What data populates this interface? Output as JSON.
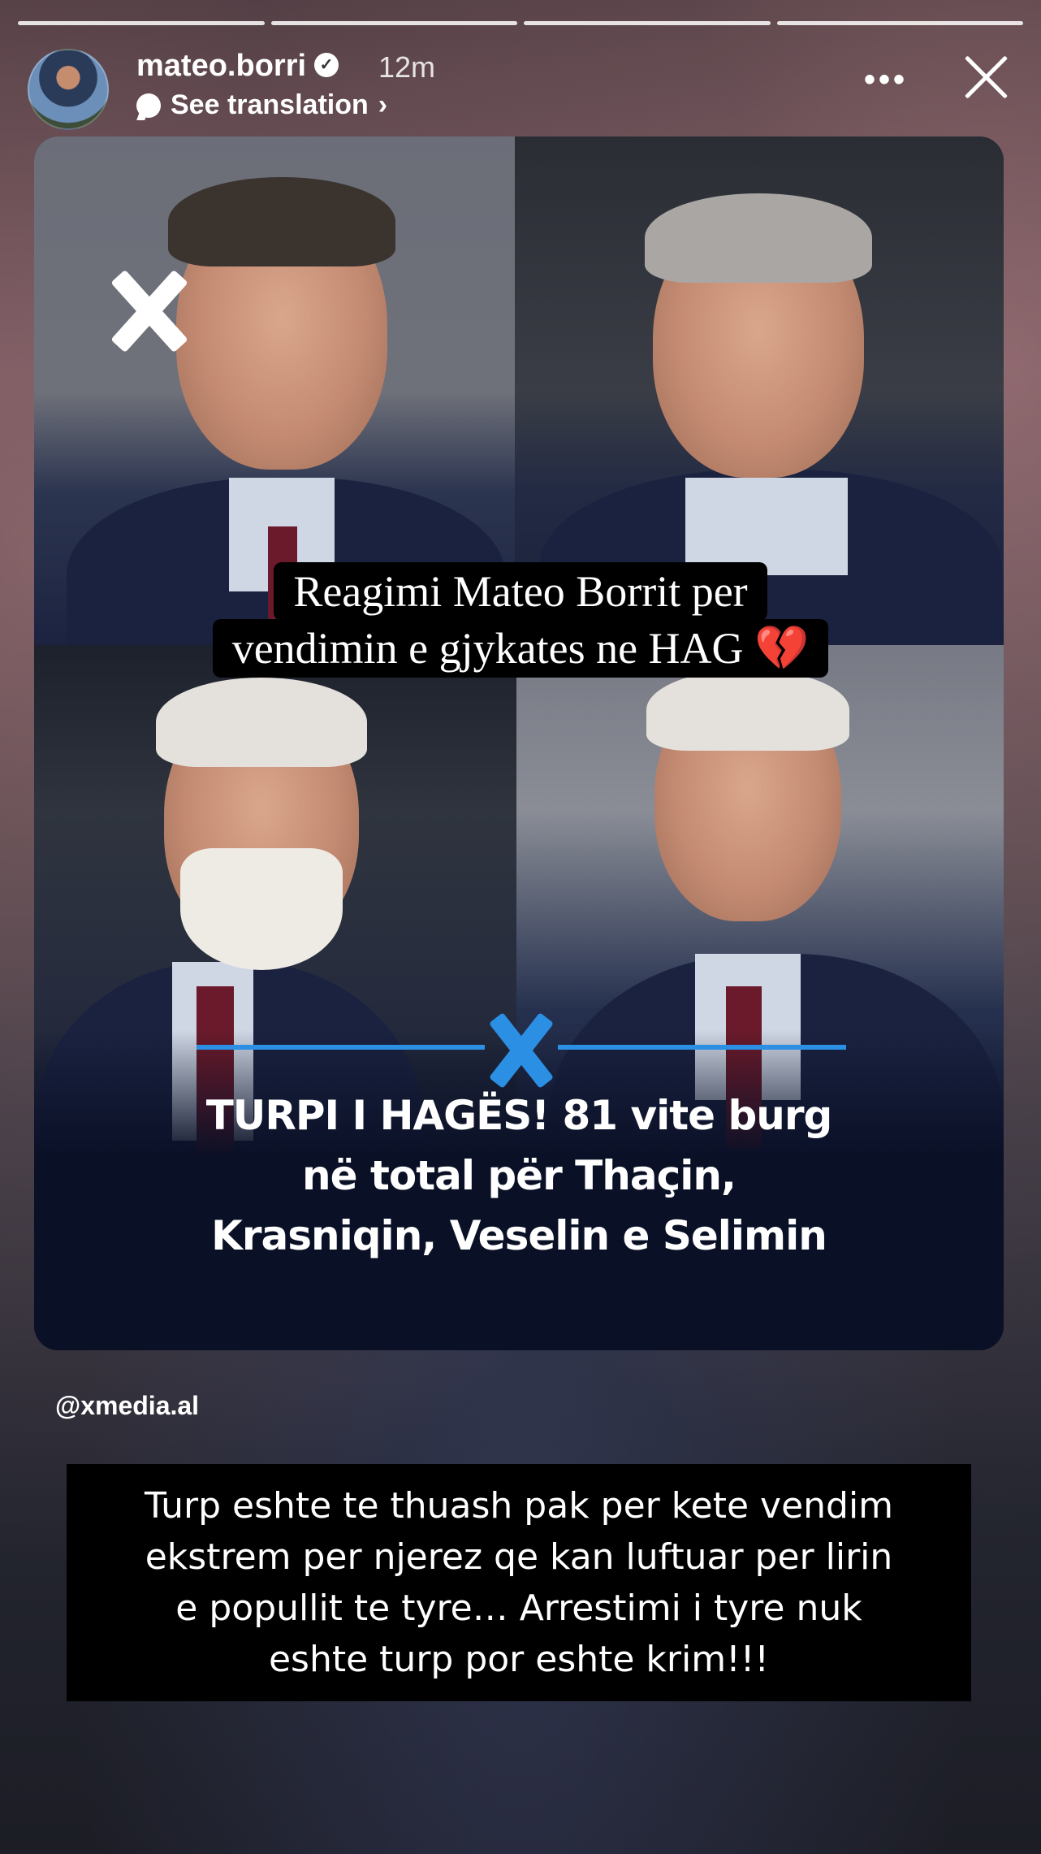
{
  "story": {
    "username": "mateo.borri",
    "verified_icon": "verified-badge-icon",
    "time_ago": "12m",
    "see_translation": "See translation",
    "more": "•••",
    "progress_segments": 4
  },
  "post": {
    "overlay_title_line1": "Reagimi Mateo Borrit per",
    "overlay_title_line2": "vendimin e gjykates ne HAG",
    "overlay_emoji": "💔",
    "headline_line1": "TURPI I HAGËS! 81 vite burg",
    "headline_line2": "në total për Thaçin,",
    "headline_line3": "Krasniqin, Veselin e Selimin",
    "source": "@xmedia.al"
  },
  "caption": {
    "line1": "Turp eshte te thuash pak per kete vendim",
    "line2": "ekstrem per njerez qe kan luftuar per lirin",
    "line3": "e popullit te tyre… Arrestimi i tyre nuk",
    "line4": "eshte turp por eshte krim!!!"
  },
  "colors": {
    "accent_blue": "#2b8fe3",
    "heart_red": "#c4161c"
  }
}
